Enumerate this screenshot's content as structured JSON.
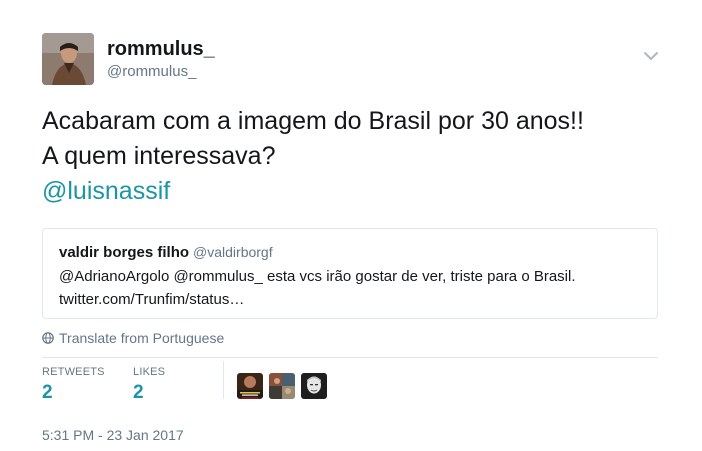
{
  "author": {
    "display_name": "rommulus_",
    "handle": "@rommulus_"
  },
  "tweet": {
    "line1": "Acabaram com a imagem do Brasil por 30 anos!!",
    "line2": "A quem interessava?",
    "mention": "@luisnassif"
  },
  "quoted": {
    "name": "valdir borges filho",
    "handle": "@valdirborgf",
    "text_line1": "@AdrianoArgolo @rommulus_  esta vcs irão gostar de ver, triste para o Brasil.",
    "text_line2": "twitter.com/Trunfim/status…"
  },
  "translate_label": "Translate from Portuguese",
  "stats": {
    "retweets_label": "RETWEETS",
    "retweets_value": "2",
    "likes_label": "LIKES",
    "likes_value": "2"
  },
  "timestamp": "5:31 PM - 23 Jan 2017",
  "icons": [
    "chevron-down-icon",
    "globe-icon"
  ],
  "colors": {
    "accent": "#1b95a5",
    "muted": "#657786",
    "border": "#e1e8ed",
    "text": "#14171a"
  }
}
